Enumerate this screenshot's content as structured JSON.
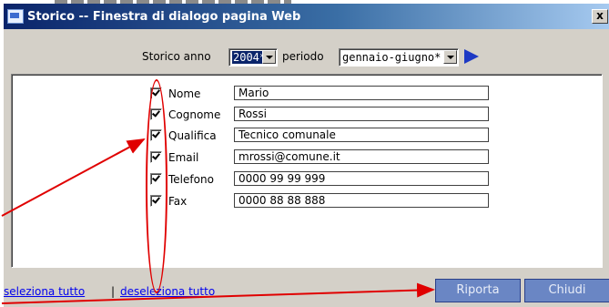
{
  "window": {
    "title": "Storico -- Finestra di dialogo pagina Web",
    "close_label": "x"
  },
  "filters": {
    "year_label": "Storico anno",
    "year_value": "2004*",
    "period_label": "periodo",
    "period_value": "gennaio-giugno*"
  },
  "fields": [
    {
      "label": "Nome",
      "value": "Mario",
      "checked": true
    },
    {
      "label": "Cognome",
      "value": "Rossi",
      "checked": true
    },
    {
      "label": "Qualifica",
      "value": "Tecnico comunale",
      "checked": true
    },
    {
      "label": "Email",
      "value": "mrossi@comune.it",
      "checked": true
    },
    {
      "label": "Telefono",
      "value": "0000 99 99 999",
      "checked": true
    },
    {
      "label": "Fax",
      "value": "0000 88 88 888",
      "checked": true
    }
  ],
  "footer": {
    "select_all": "seleziona tutto",
    "separator": "|",
    "deselect_all": "deseleziona tutto",
    "report_button": "Riporta",
    "close_button": "Chiudi"
  },
  "icons": {
    "window_icon": "ie-dialog-icon",
    "go_icon": "play-arrow-icon"
  },
  "colors": {
    "titlebar_start": "#0a246a",
    "titlebar_end": "#a6caf0",
    "dialog_face": "#d4d0c8",
    "annotation_red": "#e00000",
    "button_blue": "#6a86c4"
  }
}
